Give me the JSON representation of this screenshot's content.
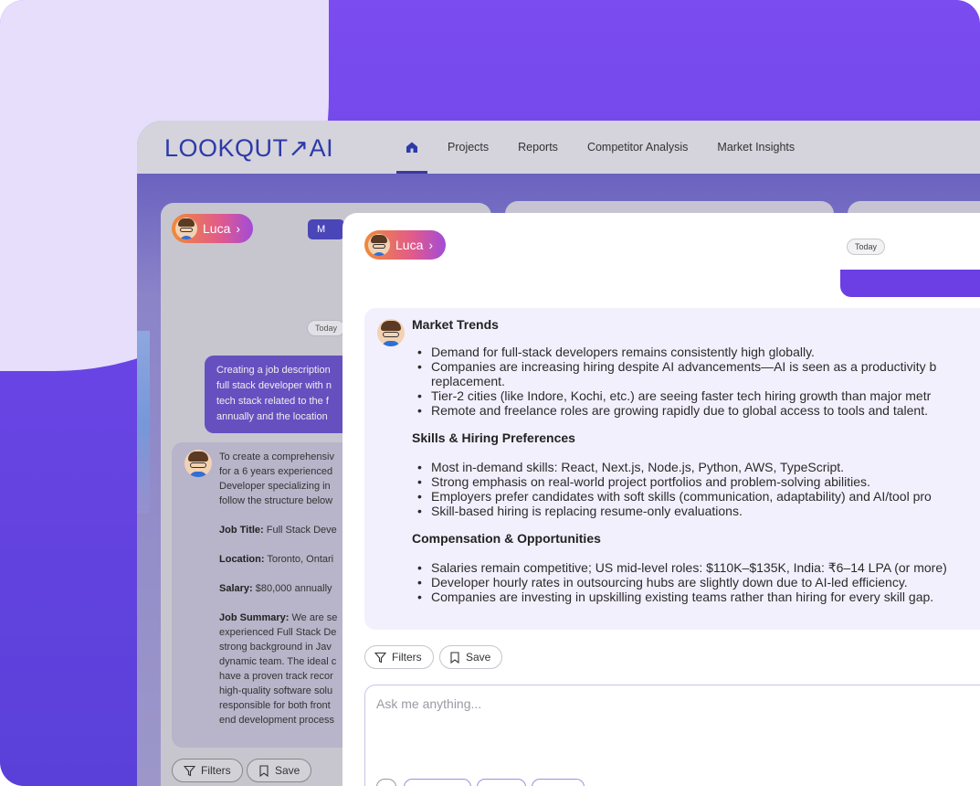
{
  "brand": {
    "logo_main": "LOOKQUT",
    "logo_suffix": "AI"
  },
  "nav": {
    "home_icon": "home-icon",
    "items": [
      {
        "label": "Projects"
      },
      {
        "label": "Reports"
      },
      {
        "label": "Competitor Analysis"
      },
      {
        "label": "Market Insights"
      }
    ]
  },
  "left_panel": {
    "agent_name": "Luca",
    "mode_button": "M",
    "date_chip": "Today",
    "user_message_lines": [
      "Creating a job description",
      "full stack developer with n",
      "tech stack related to the f",
      "annually and the location"
    ],
    "ai_message": {
      "intro_lines": [
        "To create a comprehensiv",
        "for a 6 years experienced",
        "Developer specializing in",
        "follow the structure below"
      ],
      "job_title_label": "Job Title:",
      "job_title_value": "Full Stack Deve",
      "location_label": "Location:",
      "location_value": "Toronto, Ontari",
      "salary_label": "Salary:",
      "salary_value": "$80,000 annually",
      "summary_label": "Job Summary:",
      "summary_first": "We are se",
      "summary_lines": [
        "experienced Full Stack De",
        "strong background in Jav",
        "dynamic team. The ideal c",
        "have a proven track recor",
        "high-quality software solu",
        "responsible for both front",
        "end development process"
      ]
    },
    "filters_label": "Filters",
    "save_label": "Save"
  },
  "chat": {
    "agent_name": "Luca",
    "date_chip": "Today",
    "sections": [
      {
        "title": "Market Trends",
        "bullets": [
          "Demand for full-stack developers remains consistently high globally.",
          "Companies are increasing hiring despite AI advancements—AI is seen as a productivity b",
          "replacement.",
          "Tier-2 cities (like Indore, Kochi, etc.) are seeing faster tech hiring growth than major metr",
          "Remote and freelance roles are growing rapidly due to global access to tools and talent."
        ]
      },
      {
        "title": "Skills & Hiring Preferences",
        "bullets": [
          "Most in-demand skills: React, Next.js, Node.js, Python, AWS, TypeScript.",
          "Strong emphasis on real-world project portfolios and problem-solving abilities.",
          "Employers prefer candidates with soft skills (communication, adaptability) and AI/tool pro",
          "Skill-based hiring is replacing resume-only evaluations."
        ]
      },
      {
        "title": "Compensation & Opportunities",
        "bullets": [
          "Salaries remain competitive; US mid-level roles: $110K–$135K, India: ₹6–14 LPA (or more)",
          "Developer hourly rates in outsourcing hubs are slightly down due to AI-led efficiency.",
          "Companies are investing in upskilling existing teams rather than hiring for every skill gap."
        ]
      }
    ],
    "filters_label": "Filters",
    "save_label": "Save",
    "input_placeholder": "Ask me anything..."
  },
  "colors": {
    "background_purple": "#7b4cf0",
    "brand_blue": "#2d3aa8",
    "user_bubble": "#6b3fe3",
    "ai_bubble": "#f3f0fd"
  }
}
